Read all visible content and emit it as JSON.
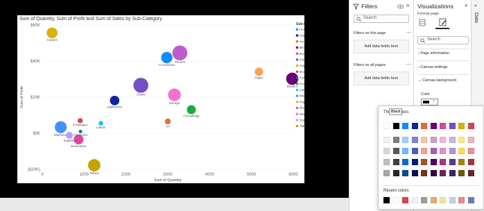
{
  "chart_data": {
    "type": "scatter",
    "title": "Sum of Quantity, Sum of Profit and Sum of Sales by Sub-Category",
    "xlabel": "Sum of Quantity",
    "ylabel": "Sum of Profit",
    "xlim": [
      0,
      6000
    ],
    "ylim": [
      -20000,
      60000
    ],
    "x_ticks": [
      "0",
      "1000",
      "2000",
      "3000",
      "4000",
      "5000",
      "6000"
    ],
    "x_tick_values": [
      0,
      1000,
      2000,
      3000,
      4000,
      5000,
      6000
    ],
    "y_ticks": [
      "($20K)",
      "$0K",
      "$20K",
      "$40K",
      "$60K"
    ],
    "y_tick_values": [
      -20000,
      0,
      20000,
      40000,
      60000
    ],
    "legend_title": "Sub-Category",
    "legend_position": "right",
    "points": [
      {
        "name": "Accessories",
        "x": 2976,
        "y": 41937,
        "size": 167380,
        "color": "#118DFF"
      },
      {
        "name": "Appliances",
        "x": 1729,
        "y": 18138,
        "size": 107532,
        "color": "#12239E"
      },
      {
        "name": "Art",
        "x": 3000,
        "y": 6528,
        "size": 27119,
        "color": "#E66C37"
      },
      {
        "name": "Binders",
        "x": 5974,
        "y": 30222,
        "size": 203413,
        "color": "#6B007B"
      },
      {
        "name": "Bookcases",
        "x": 868,
        "y": -3473,
        "size": 114880,
        "color": "#E044A7"
      },
      {
        "name": "Chairs",
        "x": 2356,
        "y": 26590,
        "size": 328449,
        "color": "#744EC2"
      },
      {
        "name": "Copiers",
        "x": 234,
        "y": 55618,
        "size": 149528,
        "color": "#D9B300"
      },
      {
        "name": "Envelopes",
        "x": 906,
        "y": 6964,
        "size": 16476,
        "color": "#D64550"
      },
      {
        "name": "Fasteners",
        "x": 914,
        "y": 950,
        "size": 3024,
        "color": "#197278"
      },
      {
        "name": "Furnishings",
        "x": 3563,
        "y": 13059,
        "size": 91705,
        "color": "#1AAB40"
      },
      {
        "name": "Labels",
        "x": 1400,
        "y": 5546,
        "size": 12486,
        "color": "#15C6F4"
      },
      {
        "name": "Machines",
        "x": 440,
        "y": 3385,
        "size": 189239,
        "color": "#4092FF"
      },
      {
        "name": "Paper",
        "x": 5178,
        "y": 34054,
        "size": 78479,
        "color": "#FFA058"
      },
      {
        "name": "Phones",
        "x": 3289,
        "y": 44516,
        "size": 330007,
        "color": "#BE5DC9"
      },
      {
        "name": "Storage",
        "x": 3158,
        "y": 21279,
        "size": 223844,
        "color": "#F472D0"
      },
      {
        "name": "Supplies",
        "x": 647,
        "y": -1189,
        "size": 46674,
        "color": "#B5A1FF"
      },
      {
        "name": "Tables",
        "x": 1241,
        "y": -17725,
        "size": 206966,
        "color": "#C4A200"
      }
    ]
  },
  "filters": {
    "title": "Filters",
    "search_placeholder": "Search",
    "on_page_label": "Filters on this page",
    "on_all_label": "Filters on all pages",
    "add_label": "Add data fields here",
    "add_label_2": "Add data fields here"
  },
  "viz": {
    "title": "Visualizations",
    "format_label": "Format page",
    "search_placeholder": "Search",
    "sections": [
      "Page information",
      "Canvas settings",
      "Canvas background"
    ],
    "color_label": "Color"
  },
  "data_tab": "Data",
  "color_picker": {
    "theme_label": "Theme colors",
    "tooltip": "Black",
    "recent_label": "Recent colors",
    "theme_top": [
      "#FFFFFF",
      "#000000",
      "#118DFF",
      "#12239E",
      "#E66C37",
      "#6B007B",
      "#E044A7",
      "#744EC2",
      "#D9B300",
      "#D64550"
    ],
    "shades": [
      [
        "#F2F2F2",
        "#7F7F7F",
        "#A0D1FF",
        "#7C87D6",
        "#F5C4AF",
        "#C8A0CE",
        "#F3B4DC",
        "#C7B7E7",
        "#FFE97F",
        "#EFB5B9"
      ],
      [
        "#D9D9D9",
        "#595959",
        "#70BBFF",
        "#4A5CC6",
        "#F0A787",
        "#A561B0",
        "#EC8DCA",
        "#AC95DA",
        "#FFDE45",
        "#E7919A"
      ],
      [
        "#BFBFBF",
        "#3F3F3F",
        "#0A6EC7",
        "#0D1A76",
        "#AD5129",
        "#50005C",
        "#A8337D",
        "#573A91",
        "#A38600",
        "#A1343C"
      ],
      [
        "#A6A6A6",
        "#262626",
        "#074C8C",
        "#091150",
        "#73361C",
        "#35003D",
        "#702254",
        "#3A2761",
        "#6C5A00",
        "#6B2328"
      ]
    ],
    "recent": [
      "#000000",
      "#FFFFFF",
      "#D64550",
      "#F3F3F3",
      "#9E9E9E",
      "#E6AC6F",
      "#F5E6A0",
      "#BFD3E6",
      "#E88A8A",
      "#6A7FB8"
    ]
  },
  "icons": {
    "filter": "funnel-icon",
    "eye": "eye-icon",
    "collapse": "chevron-double-right-icon",
    "expand": "chevron-right-icon",
    "more": "ellipsis-icon"
  }
}
